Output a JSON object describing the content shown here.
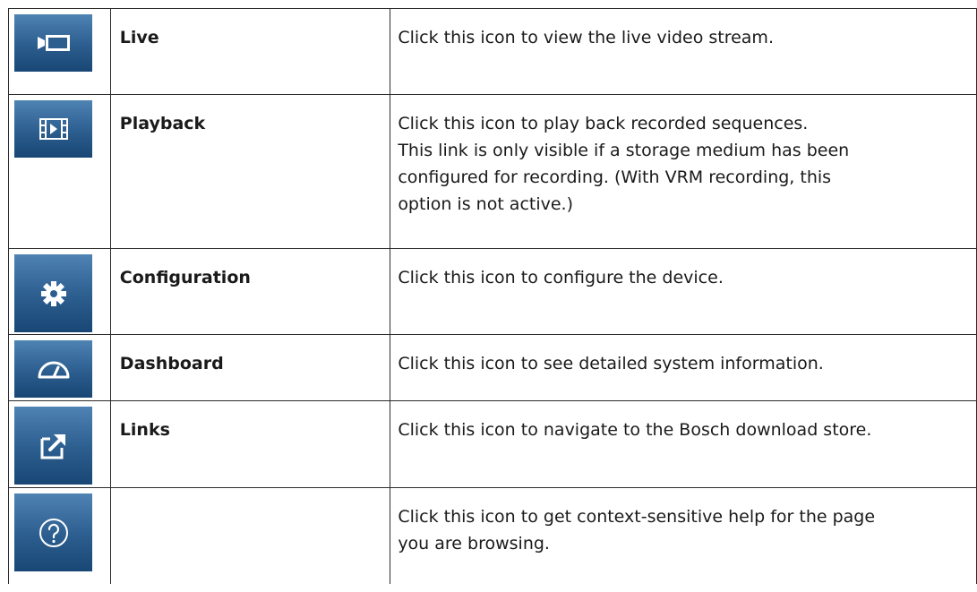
{
  "table": {
    "rows": [
      {
        "icon": "live-video-icon",
        "name": "Live",
        "description": "Click this icon to view the live video stream."
      },
      {
        "icon": "playback-icon",
        "name": "Playback",
        "description": "Click this icon to play back recorded sequences.\nThis link is only visible if a storage medium has been\nconfigured for recording. (With VRM recording, this\noption is not active.)"
      },
      {
        "icon": "gear-icon",
        "name": "Configuration",
        "description": "Click this icon to configure the device."
      },
      {
        "icon": "dashboard-gauge-icon",
        "name": "Dashboard",
        "description": "Click this icon to see detailed system information."
      },
      {
        "icon": "external-link-icon",
        "name": "Links",
        "description": "Click this icon to navigate to the Bosch download store."
      },
      {
        "icon": "help-question-icon",
        "name": "",
        "description": "Click this icon to get context-sensitive help for the page\nyou are browsing."
      }
    ]
  },
  "colors": {
    "tile_top": "#4f83b3",
    "tile_bottom": "#194775",
    "border": "#2b2b2b"
  }
}
